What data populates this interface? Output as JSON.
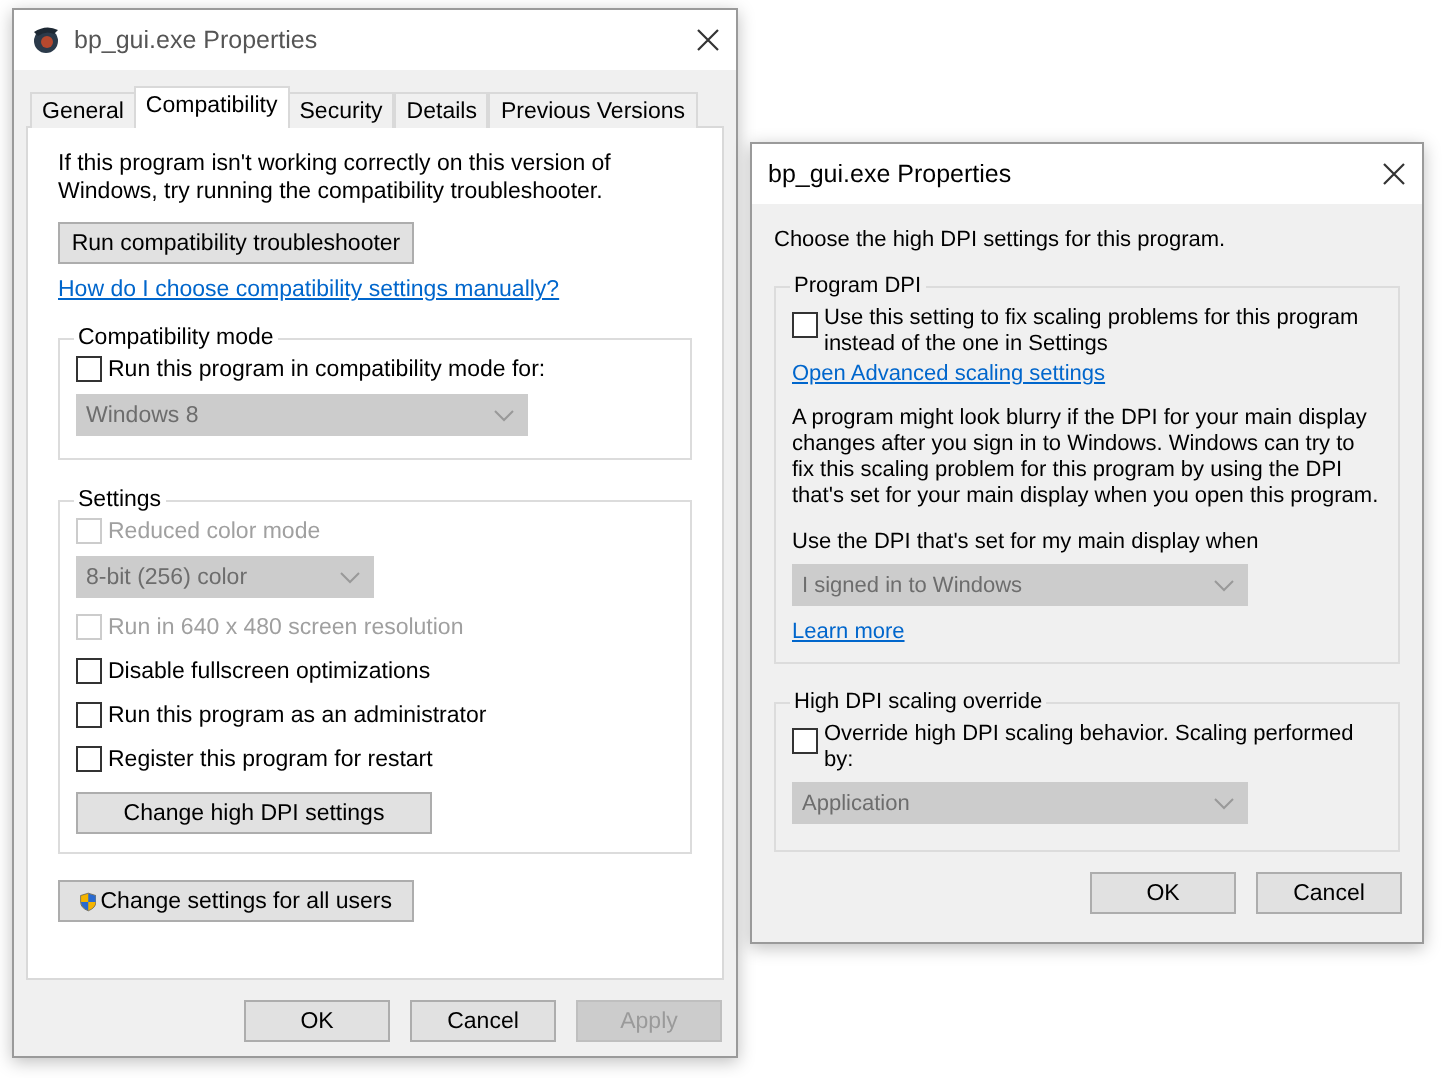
{
  "main_window": {
    "title": "bp_gui.exe Properties",
    "tabs": [
      {
        "label": "General",
        "selected": false
      },
      {
        "label": "Compatibility",
        "selected": true
      },
      {
        "label": "Security",
        "selected": false
      },
      {
        "label": "Details",
        "selected": false
      },
      {
        "label": "Previous Versions",
        "selected": false
      }
    ],
    "intro": "If this program isn't working correctly on this version of Windows, try running the compatibility troubleshooter.",
    "troubleshooter_button": "Run compatibility troubleshooter",
    "help_link": "How do I choose compatibility settings manually?",
    "compatibility_mode": {
      "legend": "Compatibility mode",
      "items": [
        {
          "kind": "checkbox",
          "label": "Run this program in compatibility mode for:",
          "checked": false,
          "disabled": false
        },
        {
          "kind": "dropdown",
          "value": "Windows 8",
          "disabled": true
        }
      ]
    },
    "settings": {
      "legend": "Settings",
      "items": [
        {
          "kind": "checkbox",
          "label": "Reduced color mode",
          "checked": false,
          "disabled": true
        },
        {
          "kind": "dropdown",
          "value": "8-bit (256) color",
          "disabled": true
        },
        {
          "kind": "checkbox",
          "label": "Run in 640 x 480 screen resolution",
          "checked": false,
          "disabled": true
        },
        {
          "kind": "checkbox",
          "label": "Disable fullscreen optimizations",
          "checked": false,
          "disabled": false
        },
        {
          "kind": "checkbox",
          "label": "Run this program as an administrator",
          "checked": false,
          "disabled": false
        },
        {
          "kind": "checkbox",
          "label": "Register this program for restart",
          "checked": false,
          "disabled": false
        },
        {
          "kind": "button",
          "label": "Change high DPI settings"
        }
      ]
    },
    "all_users_button": "Change settings for all users",
    "buttons": [
      {
        "label": "OK",
        "disabled": false
      },
      {
        "label": "Cancel",
        "disabled": false
      },
      {
        "label": "Apply",
        "disabled": true
      }
    ]
  },
  "dpi_window": {
    "title": "bp_gui.exe Properties",
    "intro": "Choose the high DPI settings for this program.",
    "groups": [
      {
        "legend": "Program DPI",
        "items": [
          {
            "kind": "checkbox",
            "label": "Use this setting to fix scaling problems for this program instead of the one in Settings",
            "checked": false,
            "disabled": false
          },
          {
            "kind": "link",
            "label": "Open Advanced scaling settings"
          },
          {
            "kind": "paragraph",
            "text": "A program might look blurry if the DPI for your main display changes after you sign in to Windows. Windows can try to fix this scaling problem for this program by using the DPI that's set for your main display when you open this program."
          },
          {
            "kind": "label",
            "text": "Use the DPI that's set for my main display when"
          },
          {
            "kind": "dropdown",
            "value": "I signed in to Windows",
            "disabled": true
          },
          {
            "kind": "link",
            "label": "Learn more"
          }
        ]
      },
      {
        "legend": "High DPI scaling override",
        "items": [
          {
            "kind": "checkbox",
            "label": "Override high DPI scaling behavior. Scaling performed by:",
            "checked": false,
            "disabled": false
          },
          {
            "kind": "dropdown",
            "value": "Application",
            "disabled": true
          }
        ]
      }
    ],
    "buttons": [
      {
        "label": "OK",
        "disabled": false
      },
      {
        "label": "Cancel",
        "disabled": false
      }
    ]
  }
}
